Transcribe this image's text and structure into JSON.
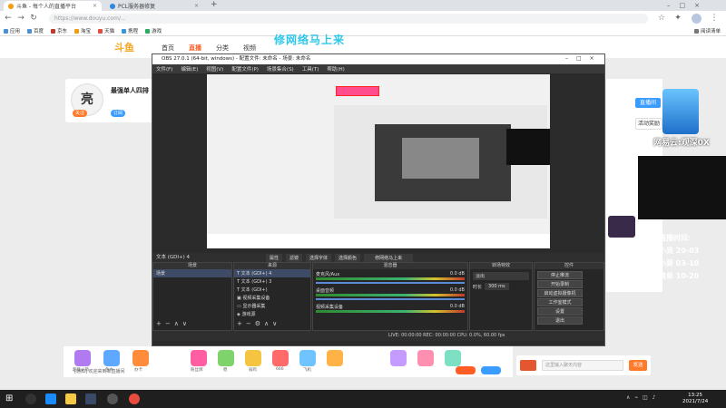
{
  "browser": {
    "tabs": [
      {
        "title": "斗鱼 - 每个人的直播平台"
      },
      {
        "title": "PCL服务器修复"
      }
    ],
    "new_tab": "+",
    "address": "https://www.douyu.com/...",
    "bookmarks": [
      "应用",
      "百度",
      "京东",
      "淘宝",
      "天猫",
      "携程",
      "游戏"
    ],
    "reading_list": "阅读清单"
  },
  "site": {
    "logo": "斗鱼",
    "nav": [
      "首页",
      "直播",
      "分类",
      "视频"
    ],
    "overlay_title": "修网络马上来"
  },
  "streamer": {
    "avatar_char": "亮",
    "name": "最强单人四排",
    "tags": [
      "关注",
      "订阅"
    ]
  },
  "obs": {
    "title": "OBS 27.0.1 (64-bit, windows) - 配置文件: 未命名 - 场景: 未命名",
    "menu": [
      "文件(F)",
      "编辑(E)",
      "视图(V)",
      "配置文件(P)",
      "场景集合(S)",
      "工具(T)",
      "帮助(H)"
    ],
    "source_bar": "文本 (GDI+) 4",
    "source_toolbar": [
      "属性",
      "滤镜",
      "选择字体",
      "选择颜色",
      "修网络马上来"
    ],
    "scenes_header": "场景",
    "scenes": [
      "场景"
    ],
    "sources_header": "来源",
    "sources": [
      "文本 (GDI+) 4",
      "文本 (GDI+) 3",
      "文本 (GDI+)",
      "视频采集设备",
      "显示器采集",
      "游戏源"
    ],
    "mixer_header": "混音器",
    "mixer": [
      {
        "name": "麦克风/Aux",
        "db": "0.0 dB"
      },
      {
        "name": "桌面音频",
        "db": "0.0 dB"
      },
      {
        "name": "视频采集设备",
        "db": "0.0 dB"
      }
    ],
    "transitions_header": "转场特效",
    "transition_type": "淡出",
    "duration_label": "时长",
    "duration_value": "300 ms",
    "controls_header": "控件",
    "controls": [
      "停止推流",
      "开始录制",
      "启动虚拟摄像机",
      "工作室模式",
      "设置",
      "退出"
    ],
    "status": "LIVE: 00:00:00    REC: 00:00:00    CPU: 0.0%, 60.00 fps"
  },
  "right_panel": {
    "live_btn": "直播间",
    "activity_btn": "活动奖励",
    "netease": "网易云:观深0X",
    "schedule": [
      "直播时间:",
      "小吴 20-03",
      "小葵 03-10",
      "简单 10-20"
    ]
  },
  "gifts": [
    {
      "name": "超级火箭"
    },
    {
      "name": "鱼丸"
    },
    {
      "name": "办卡"
    },
    {
      "name": "粉丝牌"
    },
    {
      "name": "稳"
    },
    {
      "name": "弱鸡"
    },
    {
      "name": "666"
    },
    {
      "name": "飞机"
    }
  ],
  "notice": "[通知] 欢迎来到本直播间",
  "chat": {
    "placeholder": "这里输入聊天内容",
    "send": "发送"
  },
  "clock": {
    "time": "13:25",
    "date": "2021/7/24"
  }
}
